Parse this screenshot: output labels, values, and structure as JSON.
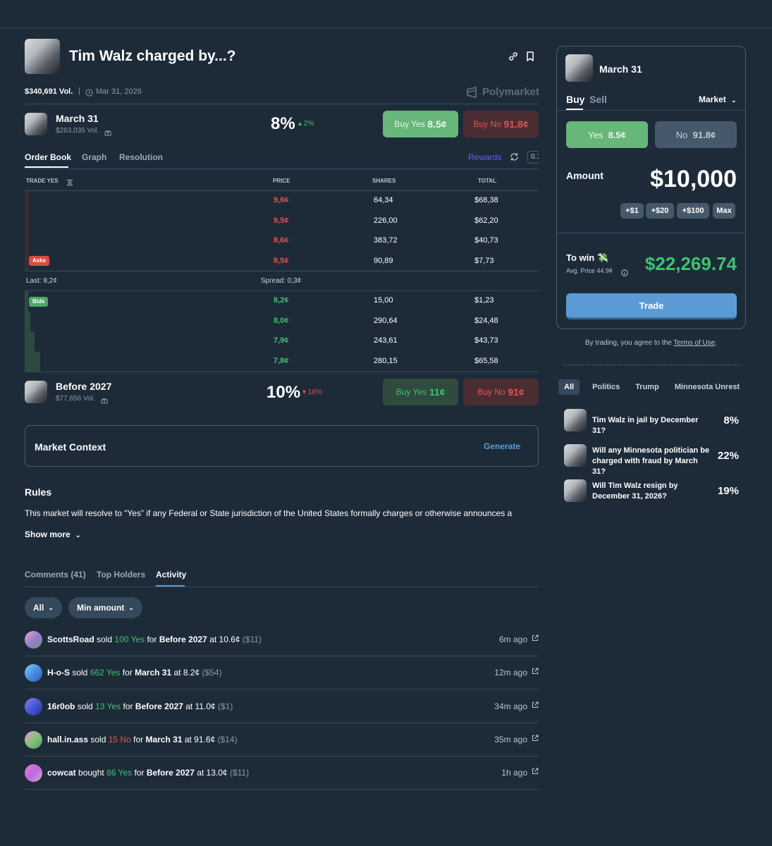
{
  "market": {
    "title": "Tim Walz charged by...?",
    "volume": "$340,691 Vol.",
    "date": "Mar 31, 2026",
    "brand": "Polymarket"
  },
  "outcomes": [
    {
      "name": "March 31",
      "volume": "$263,035 Vol.",
      "pct": "8%",
      "change": "▴ 2%",
      "buy_yes_label": "Buy Yes",
      "buy_yes_price": "8.5¢",
      "buy_no_label": "Buy No",
      "buy_no_price": "91.8¢"
    },
    {
      "name": "Before 2027",
      "volume": "$77,656 Vol.",
      "pct": "10%",
      "change": "▾ 16%",
      "buy_yes_label": "Buy Yes",
      "buy_yes_price": "11¢",
      "buy_no_label": "Buy No",
      "buy_no_price": "91¢"
    }
  ],
  "orderbook": {
    "tabs": [
      "Order Book",
      "Graph",
      "Resolution"
    ],
    "rewards": "Rewards",
    "step": "0.1",
    "headers": {
      "trade": "TRADE YES",
      "price": "PRICE",
      "shares": "SHARES",
      "total": "TOTAL"
    },
    "asks": [
      {
        "price": "9,6¢",
        "shares": "64,34",
        "total": "$68,38"
      },
      {
        "price": "9,5¢",
        "shares": "226,00",
        "total": "$62,20"
      },
      {
        "price": "8,6¢",
        "shares": "383,72",
        "total": "$40,73"
      },
      {
        "price": "8,5¢",
        "shares": "90,89",
        "total": "$7,73"
      }
    ],
    "asks_label": "Asks",
    "last": "Last: 8,2¢",
    "spread": "Spread: 0,3¢",
    "bids_label": "Bids",
    "bids": [
      {
        "price": "8,2¢",
        "shares": "15,00",
        "total": "$1,23"
      },
      {
        "price": "8,0¢",
        "shares": "290,64",
        "total": "$24,48"
      },
      {
        "price": "7,9¢",
        "shares": "243,61",
        "total": "$43,73"
      },
      {
        "price": "7,8¢",
        "shares": "280,15",
        "total": "$65,58"
      }
    ],
    "depth_levels": [
      0.1,
      0.25,
      0.55,
      0.95
    ]
  },
  "context": {
    "title": "Market Context",
    "action": "Generate"
  },
  "rules": {
    "title": "Rules",
    "text": "This market will resolve to “Yes” if any Federal or State jurisdiction of the United States formally charges or otherwise announces a",
    "show_more": "Show more"
  },
  "bottom_tabs": [
    "Comments (41)",
    "Top Holders",
    "Activity"
  ],
  "filters": {
    "all": "All",
    "min_amount": "Min amount"
  },
  "activity": [
    {
      "user": "ScottsRoad",
      "verb": "sold",
      "qty": "100 Yes",
      "side": "yes",
      "for": "for",
      "outcome": "Before 2027",
      "at": "at 10.6¢",
      "amount": "($11)",
      "time": "6m ago",
      "color": "linear-gradient(135deg,#e9a6c9,#9a7ccf,#5b9a76)"
    },
    {
      "user": "H-o-S",
      "verb": "sold",
      "qty": "662 Yes",
      "side": "yes",
      "for": "for",
      "outcome": "March 31",
      "at": "at 8.2¢",
      "amount": "($54)",
      "time": "12m ago",
      "color": "linear-gradient(135deg,#7bd3e8,#4b8fe0,#2a5bc4)"
    },
    {
      "user": "16r0ob",
      "verb": "sold",
      "qty": "13 Yes",
      "side": "yes",
      "for": "for",
      "outcome": "Before 2027",
      "at": "at 11.0¢",
      "amount": "($1)",
      "time": "34m ago",
      "color": "linear-gradient(135deg,#8c7cf0,#4657d8,#2a2f9a)"
    },
    {
      "user": "hall.in.ass",
      "verb": "sold",
      "qty": "15 No",
      "side": "no",
      "for": "for",
      "outcome": "March 31",
      "at": "at 91.6¢",
      "amount": "($14)",
      "time": "35m ago",
      "color": "linear-gradient(135deg,#e59bd0,#8ac07a,#4aa35b)"
    },
    {
      "user": "cowcat",
      "verb": "bought",
      "qty": "86 Yes",
      "side": "yes",
      "for": "for",
      "outcome": "Before 2027",
      "at": "at 13.0¢",
      "amount": "($11)",
      "time": "1h ago",
      "color": "linear-gradient(135deg,#f07ad0,#b56be0,#e7a3b8)"
    }
  ],
  "trade_panel": {
    "outcome": "March 31",
    "tabs": [
      "Buy",
      "Sell"
    ],
    "order_type": "Market",
    "yes_label": "Yes",
    "yes_price": "8.5¢",
    "no_label": "No",
    "no_price": "91.8¢",
    "amount_label": "Amount",
    "amount": "$10,000",
    "chips": [
      "+$1",
      "+$20",
      "+$100",
      "Max"
    ],
    "to_win_label": "To win 💸",
    "avg_price": "Avg. Price 44.9¢",
    "to_win": "$22,269.74",
    "trade_button": "Trade",
    "terms_prefix": "By trading, you agree to the",
    "terms_link": "Terms of Use",
    "terms_suffix": "."
  },
  "related": {
    "tags": [
      "All",
      "Politics",
      "Trump",
      "Minnesota Unrest"
    ],
    "items": [
      {
        "title": "Tim Walz in jail by December 31?",
        "pct": "8%"
      },
      {
        "title": "Will any Minnesota politician be charged with fraud by March 31?",
        "pct": "22%"
      },
      {
        "title": "Will Tim Walz resign by December 31, 2026?",
        "pct": "19%"
      }
    ]
  },
  "colors": {
    "bg": "#1d2b39",
    "green": "#3ec26f",
    "red": "#e5534b",
    "accent": "#5b9bd5"
  }
}
